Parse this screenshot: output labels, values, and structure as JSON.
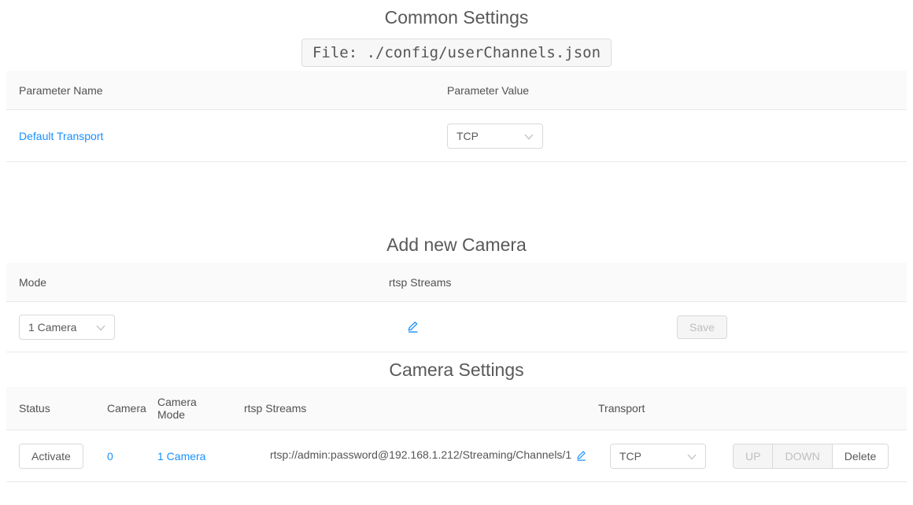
{
  "colors": {
    "accent": "#1890ff",
    "header_bg": "#fafafa",
    "row_border": "#e8e8e8",
    "control_border": "#d9d9d9",
    "disabled_text": "#bfbfbf",
    "title_text": "#595959"
  },
  "common_settings": {
    "title": "Common Settings",
    "file_label": "File: ./config/userChannels.json",
    "headers": {
      "name": "Parameter Name",
      "value": "Parameter Value"
    },
    "rows": [
      {
        "name": "Default Transport",
        "value": "TCP"
      }
    ]
  },
  "add_new_camera": {
    "title": "Add new Camera",
    "headers": {
      "mode": "Mode",
      "rtsp": "rtsp Streams"
    },
    "row": {
      "mode_value": "1 Camera",
      "save_label": "Save"
    }
  },
  "camera_settings": {
    "title": "Camera Settings",
    "headers": {
      "status": "Status",
      "camera": "Camera",
      "camera_mode": "Camera Mode",
      "rtsp": "rtsp Streams",
      "transport": "Transport"
    },
    "rows": [
      {
        "status_label": "Activate",
        "camera": "0",
        "camera_mode": "1 Camera",
        "rtsp_stream": "rtsp://admin:password@192.168.1.212/Streaming/Channels/1",
        "transport_value": "TCP",
        "up_label": "UP",
        "down_label": "DOWN",
        "delete_label": "Delete"
      }
    ]
  }
}
